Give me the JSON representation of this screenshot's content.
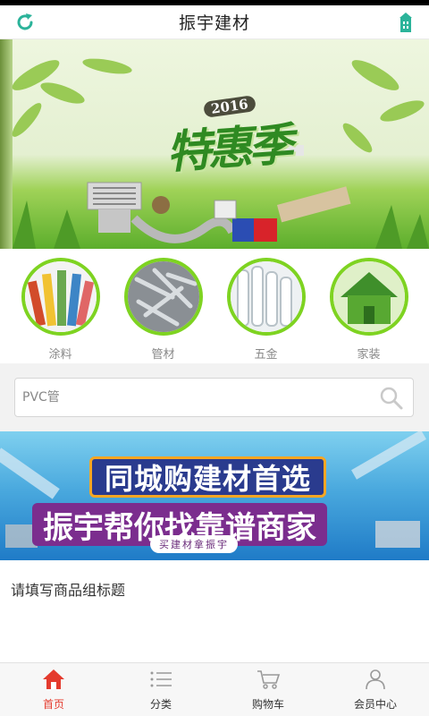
{
  "header": {
    "title": "振宇建材"
  },
  "banner_top": {
    "year": "2016",
    "headline": "特惠季"
  },
  "categories": [
    {
      "label": "涂料",
      "icon": "paint-brushes-image"
    },
    {
      "label": "管材",
      "icon": "screws-image"
    },
    {
      "label": "五金",
      "icon": "pvc-pipes-image"
    },
    {
      "label": "家装",
      "icon": "green-house-image"
    }
  ],
  "search": {
    "placeholder": "PVC管"
  },
  "banner_promo": {
    "line1": "同城购建材首选",
    "line2": "振宇帮你找靠谱商家",
    "line3": "买建材拿振宇"
  },
  "product_group": {
    "title": "请填写商品组标题"
  },
  "tabbar": {
    "items": [
      {
        "label": "首页",
        "icon": "home-icon",
        "active": true
      },
      {
        "label": "分类",
        "icon": "list-icon",
        "active": false
      },
      {
        "label": "购物车",
        "icon": "cart-icon",
        "active": false
      },
      {
        "label": "会员中心",
        "icon": "user-icon",
        "active": false
      }
    ]
  },
  "colors": {
    "accent_green": "#7ed321",
    "active_tab": "#e43b2e",
    "refresh_icon": "#2bb39a"
  }
}
